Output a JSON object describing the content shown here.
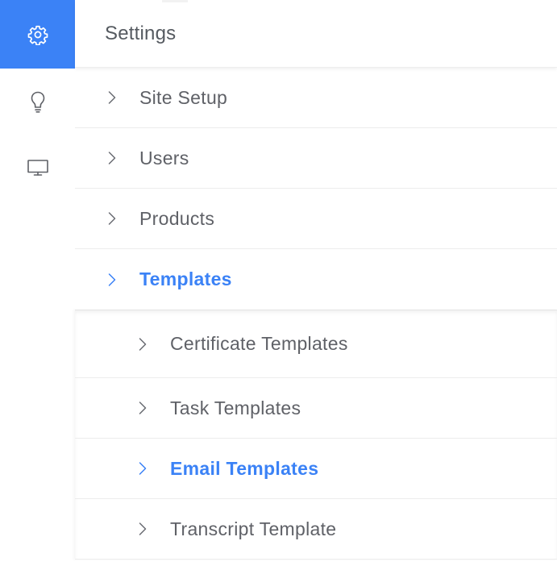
{
  "rail": {
    "items": [
      {
        "icon": "gear-icon",
        "active": true
      },
      {
        "icon": "lightbulb-icon",
        "active": false
      },
      {
        "icon": "monitor-icon",
        "active": false
      }
    ]
  },
  "header": {
    "title": "Settings"
  },
  "menu": {
    "items": [
      {
        "label": "Site Setup"
      },
      {
        "label": "Users"
      },
      {
        "label": "Products"
      },
      {
        "label": "Templates"
      }
    ],
    "submenu": [
      {
        "label": "Certificate Templates"
      },
      {
        "label": "Task Templates"
      },
      {
        "label": "Email Templates"
      },
      {
        "label": "Transcript Template"
      }
    ]
  },
  "colors": {
    "accent": "#3b82f6",
    "text": "#5f6167",
    "divider": "#ececec"
  }
}
